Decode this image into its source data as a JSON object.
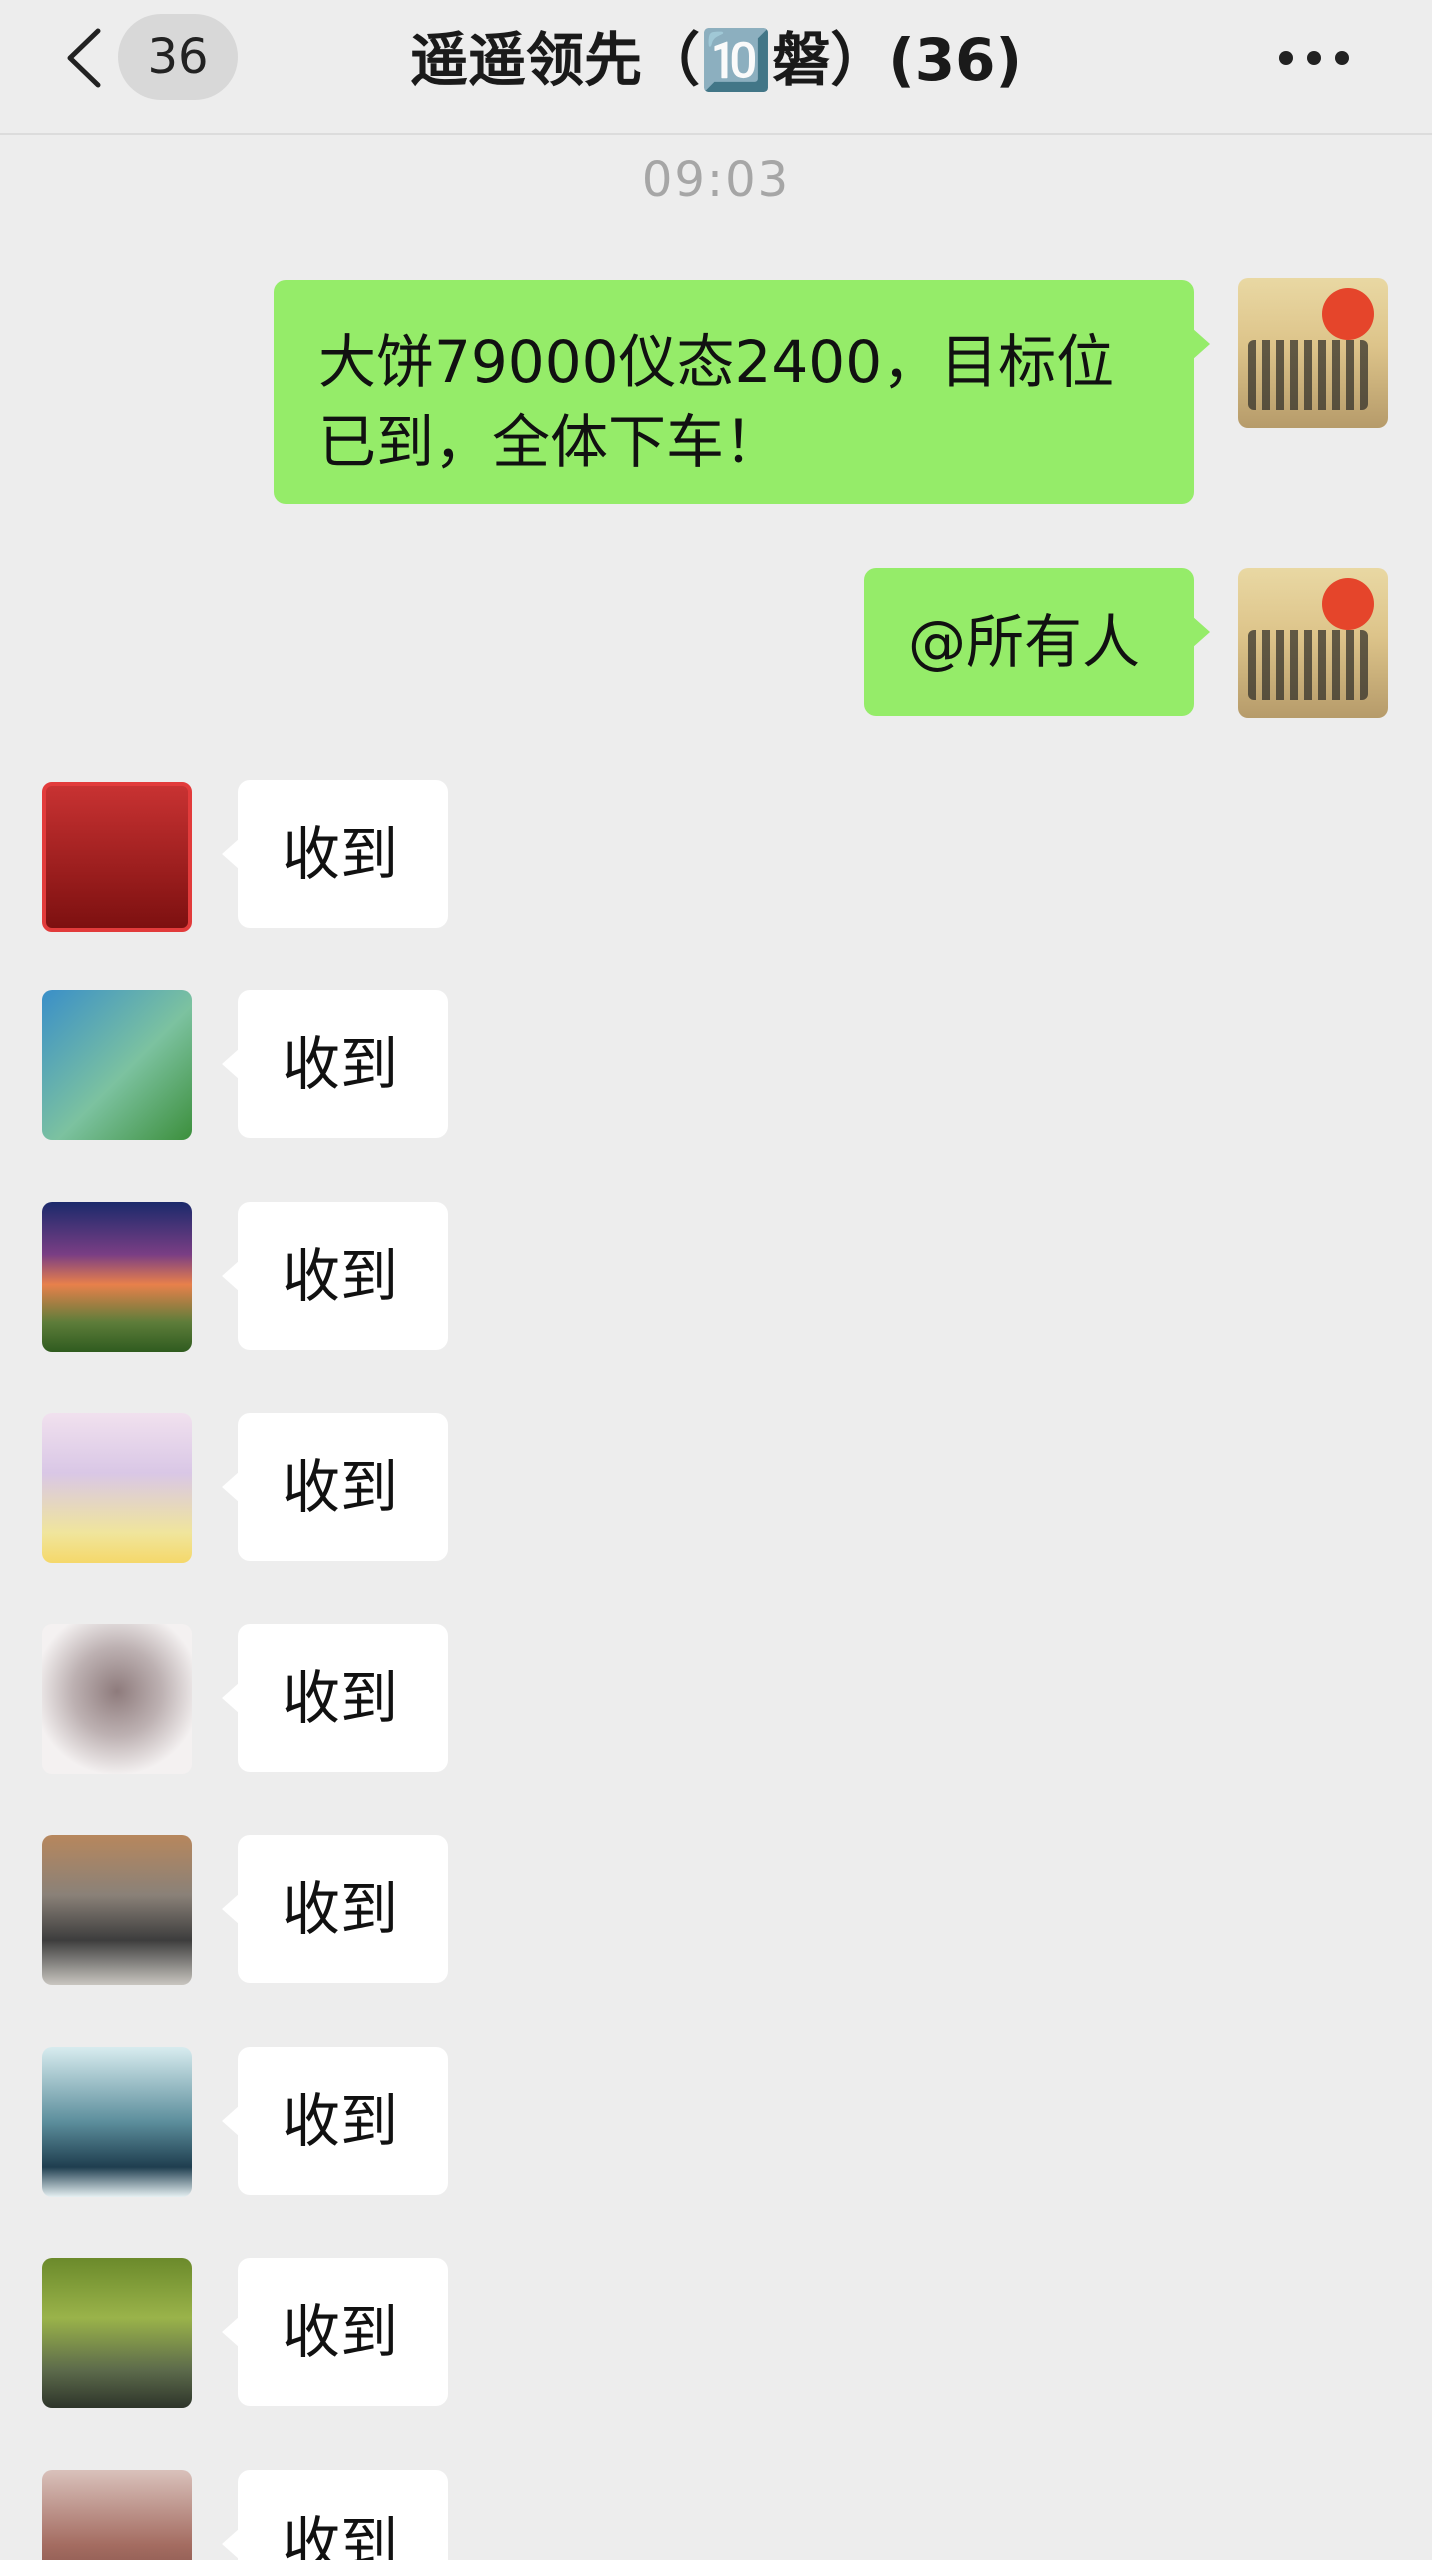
{
  "header": {
    "back_icon": "chevron-left-icon",
    "unread_count": "36",
    "title": "遥遥领先（🔟磐）(36)",
    "more_icon": "more-horizontal-icon"
  },
  "chat": {
    "timestamp": "09:03",
    "outgoing": [
      {
        "text_line1": "大饼79000仪态2400，目标位",
        "text_line2": "已到，全体下车！"
      },
      {
        "text": "@所有人"
      }
    ],
    "incoming_text": "收到",
    "incoming": [
      {
        "text": "收到"
      },
      {
        "text": "收到"
      },
      {
        "text": "收到"
      },
      {
        "text": "收到"
      },
      {
        "text": "收到"
      },
      {
        "text": "收到"
      },
      {
        "text": "收到"
      },
      {
        "text": "收到"
      },
      {
        "text": "收到"
      }
    ]
  },
  "colors": {
    "background": "#ededed",
    "outgoing_bubble": "#95ec69",
    "incoming_bubble": "#ffffff",
    "timestamp": "#a6a6a6"
  }
}
